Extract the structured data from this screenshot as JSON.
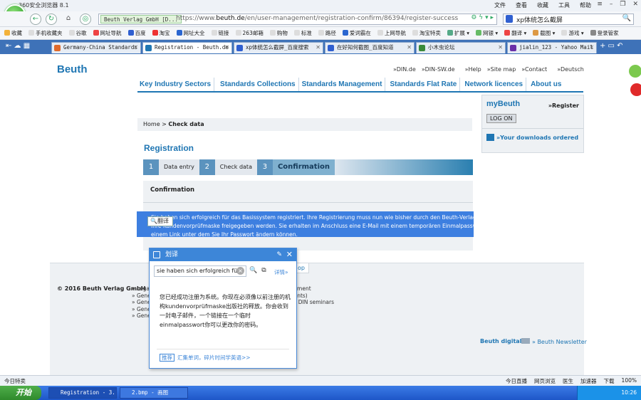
{
  "browser": {
    "title": "360安全浏览器 8.1",
    "menus": [
      "文件",
      "查看",
      "收藏",
      "工具",
      "帮助"
    ],
    "site_badge": "Beuth Verlag GmbH [D...",
    "url_prefix": "https://www.",
    "url_host": "beuth.de",
    "url_path": "/en/user-management/registration-confirm/86394/register-success",
    "search_value": "xp体统怎么截屏",
    "bookmarks": [
      "收藏",
      "手机收藏夹",
      "谷歌",
      "网址导航",
      "百度",
      "淘宝",
      "网址大全",
      "链接",
      "263邮箱",
      "购物",
      "标准",
      "路径",
      "爱词霸在",
      "上网导航",
      "淘宝特卖",
      "扩展",
      "网银",
      "翻译",
      "截图",
      "游戏",
      "登录管家"
    ],
    "tabs": [
      {
        "label": "Germany-China Standards I",
        "color": "#e06a2b"
      },
      {
        "label": "Registration - Beuth.de",
        "color": "#1f76b3"
      },
      {
        "label": "xp体统怎么截屏_百度搜索",
        "color": "#2f5fd0"
      },
      {
        "label": "在好知何截图_百度知道",
        "color": "#2f5fd0"
      },
      {
        "label": "小木虫论坛",
        "color": "#3a8a3a"
      },
      {
        "label": "jialin_123 - Yahoo Mail",
        "color": "#6a2fa8"
      }
    ],
    "status_left": "今日特卖",
    "status_right": [
      "今日直播",
      "网页浏览",
      "医生",
      "加速器",
      "下载",
      "100%"
    ]
  },
  "page": {
    "logo": "Beuth",
    "top_links": [
      "»DIN.de",
      "»DIN-SW.de",
      "»Help",
      "»Site map",
      "»Contact",
      "»Deutsch"
    ],
    "main_nav": [
      "Key Industry Sectors",
      "Standards Collections",
      "Standards Management",
      "Standards Flat Rate",
      "Network licences",
      "About us"
    ],
    "mybeuth": {
      "title": "myBeuth",
      "register": "»Register",
      "login": "LOG ON",
      "downloads": "»Your downloads ordered"
    },
    "breadcrumb_home": "Home",
    "breadcrumb_current": "Check data",
    "registration_title": "Registration",
    "steps": [
      {
        "num": "1",
        "label": "Data entry"
      },
      {
        "num": "2",
        "label": "Check data"
      },
      {
        "num": "3",
        "label": "Confirmation"
      }
    ],
    "confirmation_heading": "Confirmation",
    "selected_text_1": "Sie haben sich erfolgreich für das Basissystem registriert. Ihre Registrierung muss nun wie bisher durch den Beuth-Verlag über",
    "selected_text_2": "Ihre Kundenvorprüfmaske freigegeben werden. Sie erhalten im Anschluss eine E-Mail mit einem temporären Einmalpasswort und",
    "selected_text_3": "einem Link unter dem Sie Ihr Passwort ändern können.",
    "fanyi_button": "翻译",
    "copyright": "© 2016 Beuth Verlag GmbH",
    "footer_links": [
      "» Legal notice                                                    » Privacy statement",
      "» General terms and conditions (standards, inserts, supplements)",
      "» General terms and conditions relating to DIN conferences & DIN seminars",
      "» General technical rules       » Payment and delivery options",
      "» General terms Standards Flat Rate service"
    ],
    "top_tab": "op",
    "beuth_digital": "Beuth digital",
    "newsletter": "» Beuth Newsletter"
  },
  "translator": {
    "title": "划译",
    "input_value": "sie haben sich erfolgreich fü",
    "more_link": "详情»",
    "result": "您已经成功注册为系统。你现在必须像以前注册的机构kundenvorprüfmaske出版社的释放。你会收到一封电子邮件，一个链接在一个临时einmalpasswort你可以更改你的密码。",
    "footer_tag": "推荐",
    "footer_link": "汇集单词，碎片时间学英语>>"
  },
  "taskbar": {
    "start": "开始",
    "items": [
      "Registration - 3...",
      "2.bmp - 画图"
    ],
    "clock": "10:26"
  }
}
